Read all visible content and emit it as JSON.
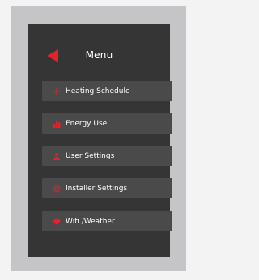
{
  "menu": {
    "title": "Menu",
    "back_icon": "back-arrow-icon",
    "items": [
      {
        "label": "Heating Schedule",
        "icon": "heating-schedule-icon"
      },
      {
        "label": "Energy Use",
        "icon": "energy-use-icon"
      },
      {
        "label": "User Settings",
        "icon": "user-settings-icon"
      },
      {
        "label": "Installer Settings",
        "icon": "installer-settings-icon"
      },
      {
        "label": "Wifi /Weather",
        "icon": "wifi-weather-icon"
      }
    ]
  },
  "colors": {
    "accent": "#e8202a",
    "screen_background": "#353535",
    "button_background": "#4a4a4a",
    "frame": "#c5c5c7",
    "text": "#ffffff"
  }
}
